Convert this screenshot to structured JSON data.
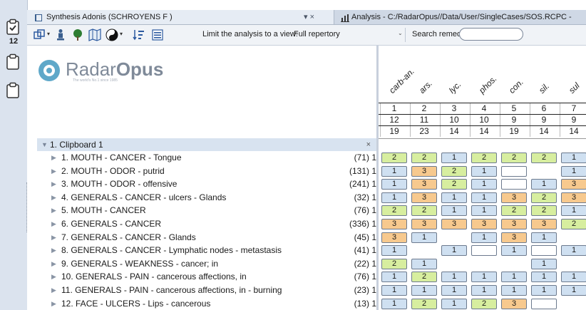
{
  "clipboards": {
    "badge": "12"
  },
  "tabs": [
    {
      "title": "Synthesis Adonis (SCHROYENS F )",
      "controls": "▾ ×"
    },
    {
      "title": "Analysis - C:/RadarOpus//Data/User/SingleCases/SOS.RCPC -",
      "controls": ""
    }
  ],
  "toolbar": {
    "limit_label": "Limit the analysis to a view:",
    "view_value": "Full repertory",
    "search_label": "Search remedy:",
    "search_value": ""
  },
  "logo": {
    "name_light": "Radar",
    "name_bold": "Opus",
    "tagline": "The world's No.1 since 1985"
  },
  "remedies": [
    "carb-an.",
    "ars.",
    "lyc.",
    "phos.",
    "con.",
    "sil.",
    "sul"
  ],
  "rank": [
    "1",
    "2",
    "3",
    "4",
    "5",
    "6",
    "7"
  ],
  "counts": [
    "12",
    "11",
    "10",
    "10",
    "9",
    "9",
    "9"
  ],
  "scores": [
    "19",
    "23",
    "14",
    "14",
    "19",
    "14",
    "14"
  ],
  "group": {
    "label": "1. Clipboard 1",
    "close": "×"
  },
  "rubrics": [
    {
      "label": "1. MOUTH - CANCER - Tongue",
      "count": "(71) 1",
      "cells": [
        2,
        2,
        1,
        2,
        2,
        2,
        1
      ]
    },
    {
      "label": "2. MOUTH - ODOR - putrid",
      "count": "(131) 1",
      "cells": [
        1,
        3,
        2,
        1,
        0,
        null,
        1
      ]
    },
    {
      "label": "3. MOUTH - ODOR - offensive",
      "count": "(241) 1",
      "cells": [
        1,
        3,
        2,
        1,
        0,
        1,
        3
      ]
    },
    {
      "label": "4. GENERALS - CANCER - ulcers - Glands",
      "count": "(32) 1",
      "cells": [
        1,
        3,
        1,
        1,
        3,
        2,
        3
      ]
    },
    {
      "label": "5. MOUTH - CANCER",
      "count": "(76) 1",
      "cells": [
        2,
        2,
        1,
        1,
        2,
        2,
        1
      ]
    },
    {
      "label": "6. GENERALS - CANCER",
      "count": "(336) 1",
      "cells": [
        3,
        3,
        3,
        3,
        3,
        3,
        2
      ]
    },
    {
      "label": "7. GENERALS - CANCER - Glands",
      "count": "(45) 1",
      "cells": [
        3,
        1,
        null,
        1,
        3,
        1,
        null
      ]
    },
    {
      "label": "8. GENERALS - CANCER - Lymphatic nodes - metastasis",
      "count": "(41) 1",
      "cells": [
        1,
        null,
        1,
        0,
        1,
        0,
        1
      ]
    },
    {
      "label": "9. GENERALS - WEAKNESS - cancer; in",
      "count": "(22) 1",
      "cells": [
        2,
        1,
        null,
        null,
        null,
        1,
        null
      ]
    },
    {
      "label": "10. GENERALS - PAIN - cancerous affections, in",
      "count": "(76) 1",
      "cells": [
        1,
        2,
        1,
        1,
        1,
        1,
        1
      ]
    },
    {
      "label": "11. GENERALS - PAIN - cancerous affections, in - burning",
      "count": "(23) 1",
      "cells": [
        1,
        1,
        1,
        1,
        1,
        1,
        1
      ]
    },
    {
      "label": "12. FACE - ULCERS - Lips - cancerous",
      "count": "(13) 1",
      "cells": [
        1,
        2,
        1,
        2,
        3,
        0,
        null
      ]
    }
  ],
  "colors": {
    "grade1": "#cfe0f1",
    "grade2": "#d7ee9f",
    "grade3": "#f7c98e"
  }
}
